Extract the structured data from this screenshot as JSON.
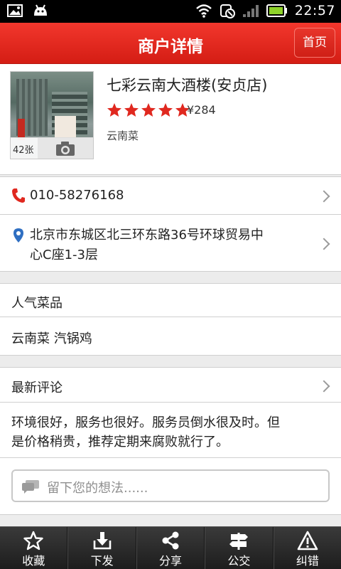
{
  "status_bar": {
    "time": "22:57"
  },
  "header": {
    "title": "商户详情",
    "home_label": "首页"
  },
  "shop": {
    "name": "七彩云南大酒楼(安贞店)",
    "photo_count": "42张",
    "rating_stars": 5,
    "price": "¥284",
    "cuisine": "云南菜"
  },
  "contact": {
    "phone": "010-58276168",
    "address_line1": "北京市东城区北三环东路36号环球贸易中",
    "address_line2": "心C座1-3层"
  },
  "popular": {
    "heading": "人气菜品",
    "items": "云南菜 汽锅鸡"
  },
  "reviews": {
    "heading": "最新评论",
    "line1": "环境很好，服务也很好。服务员倒水很及时。但",
    "line2": "是价格稍贵，推荐定期来腐败就行了。"
  },
  "comment": {
    "placeholder": "留下您的想法......"
  },
  "toolbar": {
    "items": [
      {
        "label": "收藏",
        "icon": "star-icon"
      },
      {
        "label": "下发",
        "icon": "download-icon"
      },
      {
        "label": "分享",
        "icon": "share-icon"
      },
      {
        "label": "公交",
        "icon": "bus-sign-icon"
      },
      {
        "label": "纠错",
        "icon": "warning-icon"
      }
    ]
  },
  "colors": {
    "brand_red": "#e0281f",
    "star_red": "#e0281f",
    "toolbar_dark": "#2a2a2a"
  }
}
